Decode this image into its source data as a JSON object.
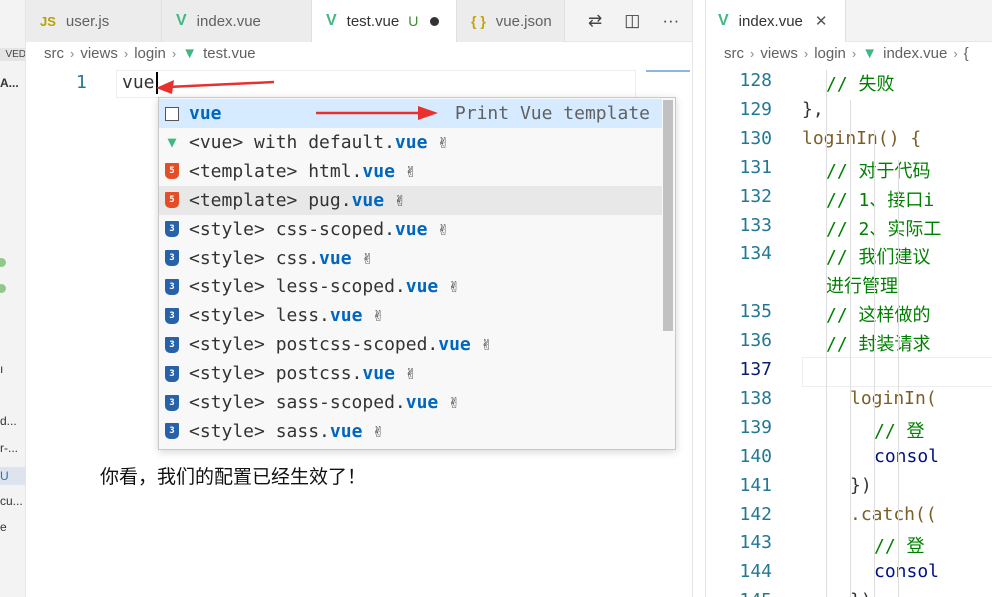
{
  "sidebar": {
    "saved_label": "VED",
    "a_label": "A...",
    "items": [
      "d...",
      "r-...",
      "U",
      "cu...",
      "e"
    ]
  },
  "left": {
    "tabs": [
      {
        "icon": "JS",
        "label": "user.js"
      },
      {
        "icon": "V",
        "label": "index.vue"
      },
      {
        "icon": "V",
        "label": "test.vue",
        "status": "U"
      },
      {
        "icon": "{ }",
        "label": "vue.json"
      }
    ],
    "breadcrumb": [
      "src",
      "views",
      "login",
      "test.vue"
    ],
    "line_number": "1",
    "code": "vue",
    "suggestions": [
      {
        "icon": "snippet",
        "prefix": "",
        "match": "vue",
        "suffix": "",
        "detail": "Print Vue template"
      },
      {
        "icon": "vue",
        "prefix": "<vue> with default.",
        "match": "vue",
        "suffix": "",
        "hand": "✌"
      },
      {
        "icon": "html",
        "prefix": "<template> html.",
        "match": "vue",
        "suffix": "",
        "hand": "✌"
      },
      {
        "icon": "html",
        "prefix": "<template> pug.",
        "match": "vue",
        "suffix": "",
        "hand": "✌"
      },
      {
        "icon": "css",
        "prefix": "<style> css-scoped.",
        "match": "vue",
        "suffix": "",
        "hand": "✌"
      },
      {
        "icon": "css",
        "prefix": "<style> css.",
        "match": "vue",
        "suffix": "",
        "hand": "✌"
      },
      {
        "icon": "css",
        "prefix": "<style> less-scoped.",
        "match": "vue",
        "suffix": "",
        "hand": "✌"
      },
      {
        "icon": "css",
        "prefix": "<style> less.",
        "match": "vue",
        "suffix": "",
        "hand": "✌"
      },
      {
        "icon": "css",
        "prefix": "<style> postcss-scoped.",
        "match": "vue",
        "suffix": "",
        "hand": "✌"
      },
      {
        "icon": "css",
        "prefix": "<style> postcss.",
        "match": "vue",
        "suffix": "",
        "hand": "✌"
      },
      {
        "icon": "css",
        "prefix": "<style> sass-scoped.",
        "match": "vue",
        "suffix": "",
        "hand": "✌"
      },
      {
        "icon": "css",
        "prefix": "<style> sass.",
        "match": "vue",
        "suffix": "",
        "hand": "✌"
      }
    ],
    "caption": "你看，我们的配置已经生效了！"
  },
  "right": {
    "tab_label": "index.vue",
    "breadcrumb": [
      "src",
      "views",
      "login",
      "index.vue",
      "{"
    ],
    "lines": [
      {
        "num": "128",
        "code": "//    失败",
        "kind": "cmt"
      },
      {
        "num": "129",
        "code": "},",
        "kind": "plain"
      },
      {
        "num": "130",
        "code": "loginIn() {",
        "kind": "fn"
      },
      {
        "num": "131",
        "code": "// 对于代码",
        "kind": "cmt"
      },
      {
        "num": "132",
        "code": "// 1、接口i",
        "kind": "cmt"
      },
      {
        "num": "133",
        "code": "// 2、实际工",
        "kind": "cmt"
      },
      {
        "num": "134",
        "code": "// 我们建议",
        "kind": "cmt"
      },
      {
        "num": "",
        "code": "进行管理",
        "kind": "cmt"
      },
      {
        "num": "135",
        "code": "// 这样做的",
        "kind": "cmt"
      },
      {
        "num": "136",
        "code": "// 封装请求",
        "kind": "cmt"
      },
      {
        "num": "137",
        "code": "",
        "kind": "plain"
      },
      {
        "num": "138",
        "code": "loginIn(",
        "kind": "fn"
      },
      {
        "num": "139",
        "code": "//   登",
        "kind": "cmt"
      },
      {
        "num": "140",
        "code": "consol",
        "kind": "var"
      },
      {
        "num": "141",
        "code": "})",
        "kind": "plain"
      },
      {
        "num": "142",
        "code": ".catch((",
        "kind": "fn"
      },
      {
        "num": "143",
        "code": "//   登",
        "kind": "cmt"
      },
      {
        "num": "144",
        "code": "consol",
        "kind": "var"
      },
      {
        "num": "145",
        "code": "})",
        "kind": "plain"
      }
    ]
  }
}
